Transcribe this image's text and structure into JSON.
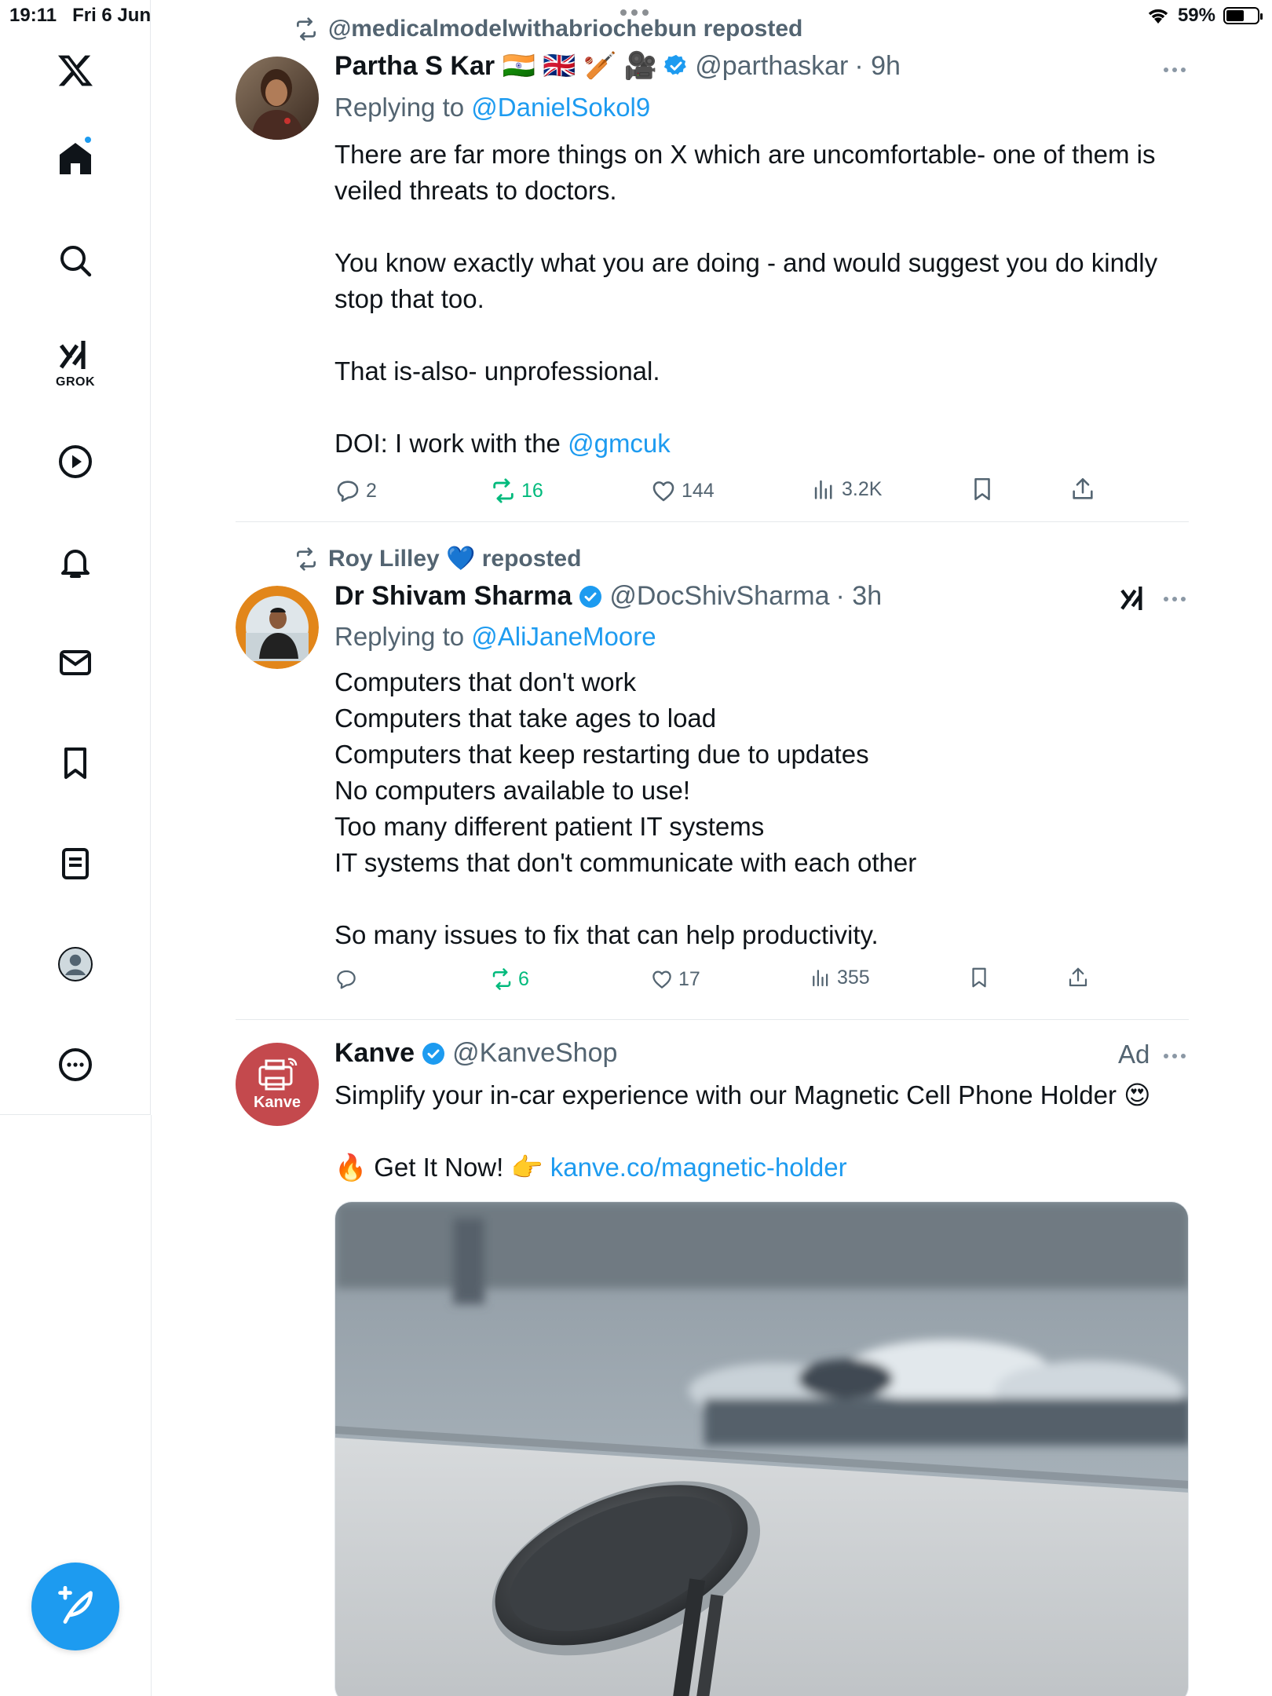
{
  "status_bar": {
    "time": "19:11",
    "date": "Fri 6 Jun",
    "battery": "59%",
    "battery_level": 0.59
  },
  "sidebar": {
    "logo": "x-logo-icon",
    "items": [
      {
        "name": "home",
        "icon": "home-icon"
      },
      {
        "name": "explore",
        "icon": "search-icon"
      },
      {
        "name": "grok",
        "icon": "grok-icon",
        "label": "GROK"
      },
      {
        "name": "videos",
        "icon": "play-icon"
      },
      {
        "name": "notifications",
        "icon": "bell-icon"
      },
      {
        "name": "messages",
        "icon": "mail-icon"
      },
      {
        "name": "bookmarks",
        "icon": "bookmark-icon"
      },
      {
        "name": "lists",
        "icon": "list-icon"
      },
      {
        "name": "profile",
        "icon": "profile-icon"
      },
      {
        "name": "more",
        "icon": "more-icon"
      }
    ],
    "compose": "compose-icon"
  },
  "tweets": [
    {
      "repost_by": "@medicalmodelwithabriochebun reposted",
      "name": "Partha S Kar 🇮🇳 🇬🇧 🏏 🎥",
      "handle": "@parthaskar",
      "time": "· 9h",
      "replying_prefix": "Replying to",
      "replying_to": "@DanielSokol9",
      "body_main": "There are far more things on X which are uncomfortable- one of them is veiled threats to doctors.\n\nYou know exactly what you are doing - and would suggest you do kindly stop that too.\n\nThat is-also- unprofessional.\n\n",
      "body_prefix": "DOI: I work with the ",
      "body_link": "@gmcuk",
      "replies": "2",
      "reposts": "16",
      "likes": "144",
      "views": "3.2K"
    },
    {
      "repost_by": "Roy Lilley 💙 reposted",
      "name": "Dr Shivam Sharma",
      "handle": "@DocShivSharma",
      "time": "· 3h",
      "replying_prefix": "Replying to",
      "replying_to": "@AliJaneMoore",
      "body_main": "Computers that don't work\nComputers that take ages to load\nComputers that keep restarting due to updates\nNo computers available to use!\nToo many different patient IT systems\nIT systems that don't communicate with each other\n\nSo many issues to fix that can help productivity.",
      "replies": "",
      "reposts": "6",
      "likes": "17",
      "views": "355"
    },
    {
      "name": "Kanve",
      "handle": "@KanveShop",
      "ad": "Ad",
      "avatar_text": "Kanve",
      "body_main": "Simplify your in-car experience with our Magnetic Cell Phone Holder 😍\n\n",
      "body_prefix": "🔥 Get It Now! 👉 ",
      "body_link": "kanve.co/magnetic-holder"
    }
  ],
  "colors": {
    "accent": "#1d9bf0",
    "repost_green": "#00ba7c",
    "secondary_text": "#536471"
  }
}
